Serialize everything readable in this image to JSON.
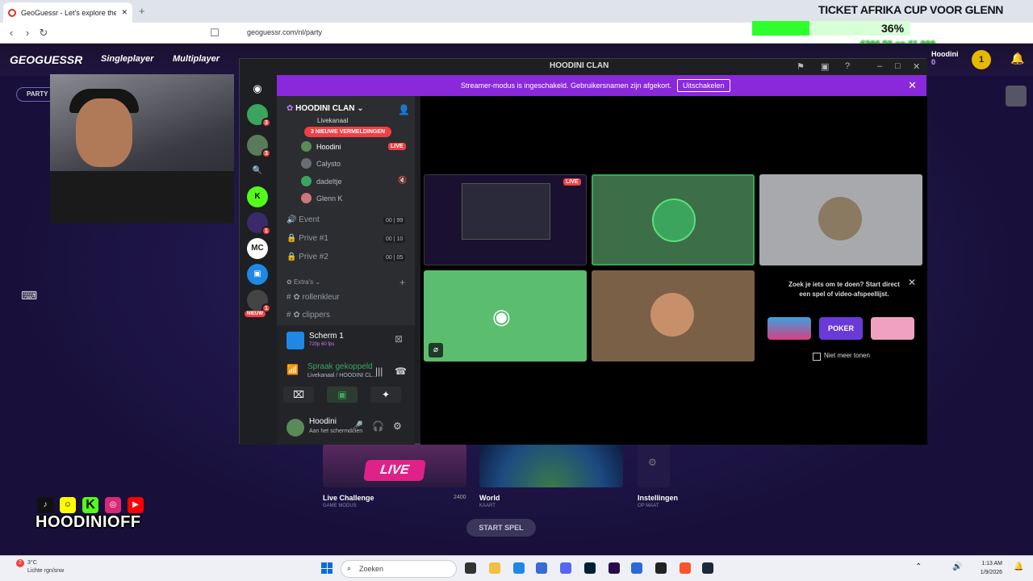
{
  "browser": {
    "tab_title": "GeoGuessr - Let's explore the world",
    "url": "geoguessr.com/nl/party"
  },
  "overlay": {
    "title": "TICKET AFRIKA CUP VOOR GLENN",
    "progress_pct": "36%",
    "progress_fraction": 0.36,
    "amount": "€366.50 on €1,000"
  },
  "geo": {
    "logo": "GEOGUESSR",
    "nav": [
      "Singleplayer",
      "Multiplayer"
    ],
    "party_button": "PARTY ONTBR",
    "user_name": "Hoodini",
    "user_level": "0",
    "coin": "1",
    "cards": [
      {
        "title": "Live Challenge",
        "sub": "GAME MODUS",
        "badge": "LIVE",
        "count": "2400"
      },
      {
        "title": "World",
        "sub": "KAART"
      },
      {
        "title": "Instellingen",
        "sub": "OP MAAT"
      }
    ],
    "start": "START SPEL"
  },
  "socials": {
    "brand": "HOODINIOFF"
  },
  "discord": {
    "window_title": "HOODINI CLAN",
    "streamer_banner": "Streamer-modus is ingeschakeld. Gebruikersnamen zijn afgekort.",
    "streamer_off": "Uitschakelen",
    "server_name": "HOODINI CLAN",
    "new_mentions": "3 NIEUWE VERMELDINGEN",
    "current_channel": "Livekanaal",
    "voice_users": [
      {
        "name": "Hoodini",
        "live": "LIVE"
      },
      {
        "name": "Calysto"
      },
      {
        "name": "dadeltje"
      },
      {
        "name": "Glenn K"
      }
    ],
    "voice_channels": [
      {
        "name": "Event",
        "a": "00",
        "b": "99"
      },
      {
        "name": "Prive #1",
        "a": "00",
        "b": "10"
      },
      {
        "name": "Prive #2",
        "a": "00",
        "b": "05"
      }
    ],
    "category": "Extra's",
    "text_channels": [
      "rollenkleur",
      "clippers"
    ],
    "server_badges": {
      "dm": "3",
      "s2": "3",
      "s3": "1",
      "s4": "1",
      "new": "NIEUW"
    },
    "server_mc": "MC",
    "screen": {
      "title": "Scherm 1",
      "sub": "720p 60 fps"
    },
    "voice": {
      "status": "Spraak gekoppeld",
      "channel": "Livekanaal / HOODINI CL..."
    },
    "user": {
      "name": "Hoodini",
      "status": "Aan het schermdelen"
    },
    "tile_live": "LIVE",
    "activity": {
      "text": "Zoek je iets om te doen? Start direct een spel of video-afspeellijst.",
      "games": [
        "POKER"
      ],
      "no_more": "Niet meer tonen"
    }
  },
  "taskbar": {
    "weather_temp": "3°C",
    "weather_desc": "Lichte rgn/snw",
    "search": "Zoeken",
    "notif": "2",
    "time": "1:13 AM",
    "date": "1/9/2026"
  }
}
